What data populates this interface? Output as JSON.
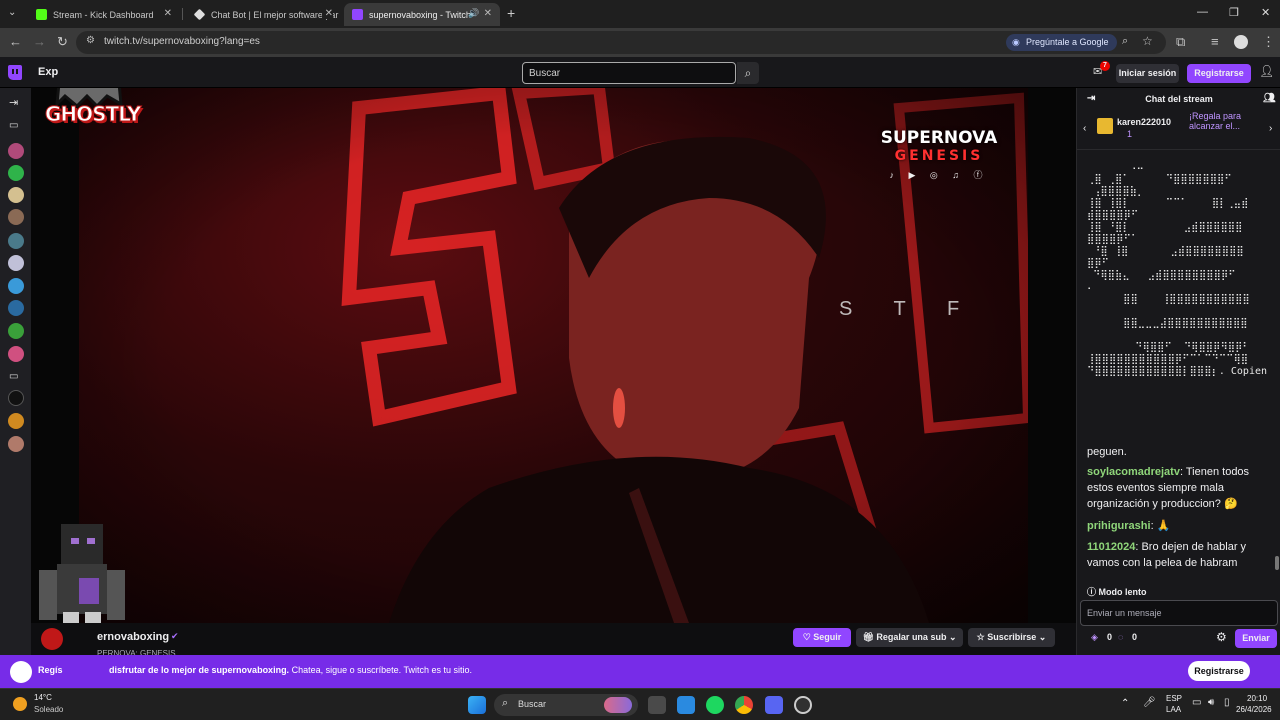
{
  "browser": {
    "tabs": [
      {
        "title": "Stream - Kick Dashboard",
        "active": false,
        "fav_color": "#53fc18"
      },
      {
        "title": "Chat Bot | El mejor software par",
        "active": false,
        "fav_color": "#dddddd"
      },
      {
        "title": "supernovaboxing - Twitch",
        "active": true,
        "fav_color": "#9146ff"
      }
    ],
    "url": "twitch.tv/supernovaboxing?lang=es",
    "gemini_button": "Pregúntale a Google"
  },
  "twitch": {
    "explore_label": "Exp",
    "search_placeholder": "Buscar",
    "notification_count": "7",
    "login_label": "Iniciar sesión",
    "signup_label": "Registrarse",
    "brand_color": "#9146ff"
  },
  "overlay": {
    "streamer_logo_text": "GHOSTLY",
    "event_title_1": "SUPERNOVA",
    "event_title_2": "GENESIS",
    "background_letters": "S T F"
  },
  "stream_info": {
    "channel_name": "supernovaboxing",
    "channel_name_visible": "ernovaboxing",
    "subtitle_partial": "PERNOVA: GENESIS",
    "follow_label": "Seguir",
    "gift_sub_label": "Regalar una sub",
    "subscribe_label": "Suscribirse"
  },
  "chat": {
    "header": "Chat del stream",
    "gift_user": "karen222010",
    "gift_count": "1",
    "gift_text": "¡Regala para alcanzar el...",
    "ascii_art": [
      "       ⠠⠤",
      "⢀⣿ ⢀⣿⠁      ⠙⣿⣿⣿⣿⣿⣿⣿⠋",
      " ⢠⣿⣿⣿⣿⣷⡀",
      "⢸⣿ ⢸⣿⡇      ⠉⠉⠁    ⣿⡇⢀⣤⣾",
      "⣾⣿⣿⣿⣿⡿⠋",
      "⢸⣿ ⠘⣿⡇         ⣠⣾⣿⣿⣿⣿⣿⣿",
      "⣿⣿⣿⣿⡿⠋⠁",
      " ⠘⣿ ⢸⣿       ⣠⣾⣿⣿⣿⣿⣿⣿⣿⣿",
      "⣿⡿⠋",
      " ⠙⢿⣿⣷⣄   ⣠⣾⣿⣿⣿⣿⣿⣿⣿⣿⡿⠋",
      "⠄",
      "      ⣿⣿    ⢸⣿⣿⣿⣿⣿⣿⣿⣿⣿⣿⣿",
      "",
      "      ⣿⣿⣀⣀⣀⣼⣿⣿⣿⣿⣿⣿⣿⣿⣿⣿⣿",
      "",
      "        ⠙⢿⣿⣿⠋  ⠙⢿⣿⣿⡿⠻⣿⡿⠃",
      "⢸⣿⣿⣿⣿⣿⣿⣿⣿⣿⣿⣿⡿⠋⠉⠁⠉⠙⠉⠉⢿⣿",
      "⠙⣿⣿⣿⣿⣿⣿⣿⣿⣿⣿⣿⣿⡇⣿⣿⣿⡆. Copien y"
    ],
    "ascii_tail": "peguen.",
    "messages": [
      {
        "user": "soylacomadrejatv",
        "text": "Tienen todos estos eventos siempre mala organización y produccion? 🤔"
      },
      {
        "user": "prihigurashi",
        "text": "🙏"
      },
      {
        "user": "11012024",
        "text": "Bro dejen de hablar y vamos con la pelea de habram"
      }
    ],
    "slow_mode_label": "Modo lento",
    "input_placeholder": "Enviar un mensaje",
    "points_1": "0",
    "points_2": "0",
    "send_label": "Enviar"
  },
  "banner": {
    "text_prefix": "Regís",
    "text_bold": "disfrutar de lo mejor de supernovaboxing.",
    "text_rest": "Chatea, sigue o suscríbete. Twitch es tu sitio.",
    "button": "Registrarse"
  },
  "taskbar": {
    "temperature": "14°C",
    "weather": "Soleado",
    "search_placeholder": "Buscar",
    "lang_1": "ESP",
    "lang_2": "LAA",
    "time": "20:10",
    "date": "26/4/2026"
  }
}
